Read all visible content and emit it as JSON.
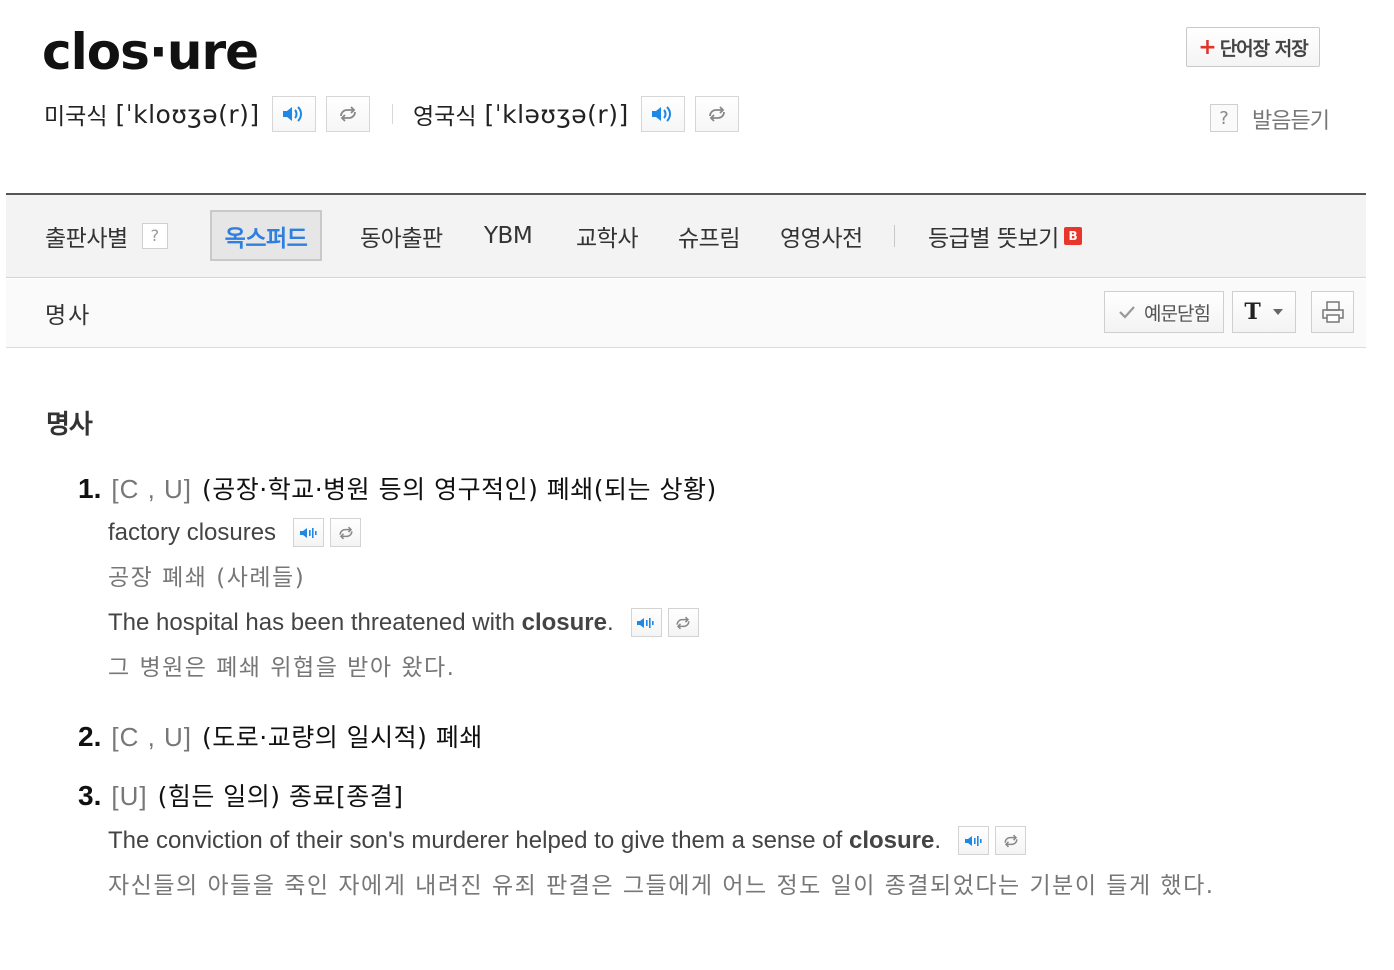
{
  "entry": {
    "headword": "clos·ure",
    "save_button": "단어장 저장",
    "save_plus": "+",
    "us_label": "미국식",
    "us_ipa": "[ˈkloʊʒə(r)]",
    "uk_label": "영국식",
    "uk_ipa": "[ˈkləʊʒə(r)]",
    "help_mark": "?",
    "listen_label": "발음듣기"
  },
  "tabs": {
    "publisher_label": "출판사별",
    "help_mark": "?",
    "items": [
      "옥스퍼드",
      "동아출판",
      "YBM",
      "교학사",
      "슈프림",
      "영영사전"
    ],
    "level_label": "등급별 뜻보기",
    "badge": "B"
  },
  "toolbar": {
    "pos_label": "명사",
    "example_toggle": "예문닫힘",
    "font_label": "T"
  },
  "content": {
    "section_title": "명사",
    "senses": [
      {
        "num": "1.",
        "gram": "[C , U]",
        "def": "(공장·학교·병원 등의 영구적인) 폐쇄(되는 상황)",
        "examples": [
          {
            "en": "factory closures",
            "en_bold": "",
            "en_after": "",
            "ko": "공장 폐쇄 (사례들)"
          },
          {
            "en": "The hospital has been threatened with ",
            "en_bold": "closure",
            "en_after": ".",
            "ko": "그 병원은 폐쇄 위협을 받아 왔다."
          }
        ]
      },
      {
        "num": "2.",
        "gram": "[C , U]",
        "def": "(도로·교량의 일시적) 폐쇄",
        "examples": []
      },
      {
        "num": "3.",
        "gram": "[U]",
        "def": "(힘든 일의) 종료[종결]",
        "examples": [
          {
            "en": "The conviction of their son's murderer helped to give them a sense of ",
            "en_bold": "closure",
            "en_after": ".",
            "ko": "자신들의 아들을 죽인 자에게 내려진 유죄 판결은 그들에게 어느 정도 일이 종결되었다는 기분이 들게 했다."
          }
        ]
      }
    ]
  },
  "icons": {
    "speaker": "speaker-icon",
    "repeat": "repeat-icon",
    "check": "check-icon",
    "print": "print-icon",
    "dropdown": "caret-down-icon"
  },
  "colors": {
    "accent_blue": "#2f7fe0",
    "red_badge": "#e8362d",
    "speaker_blue": "#1e88e5"
  }
}
